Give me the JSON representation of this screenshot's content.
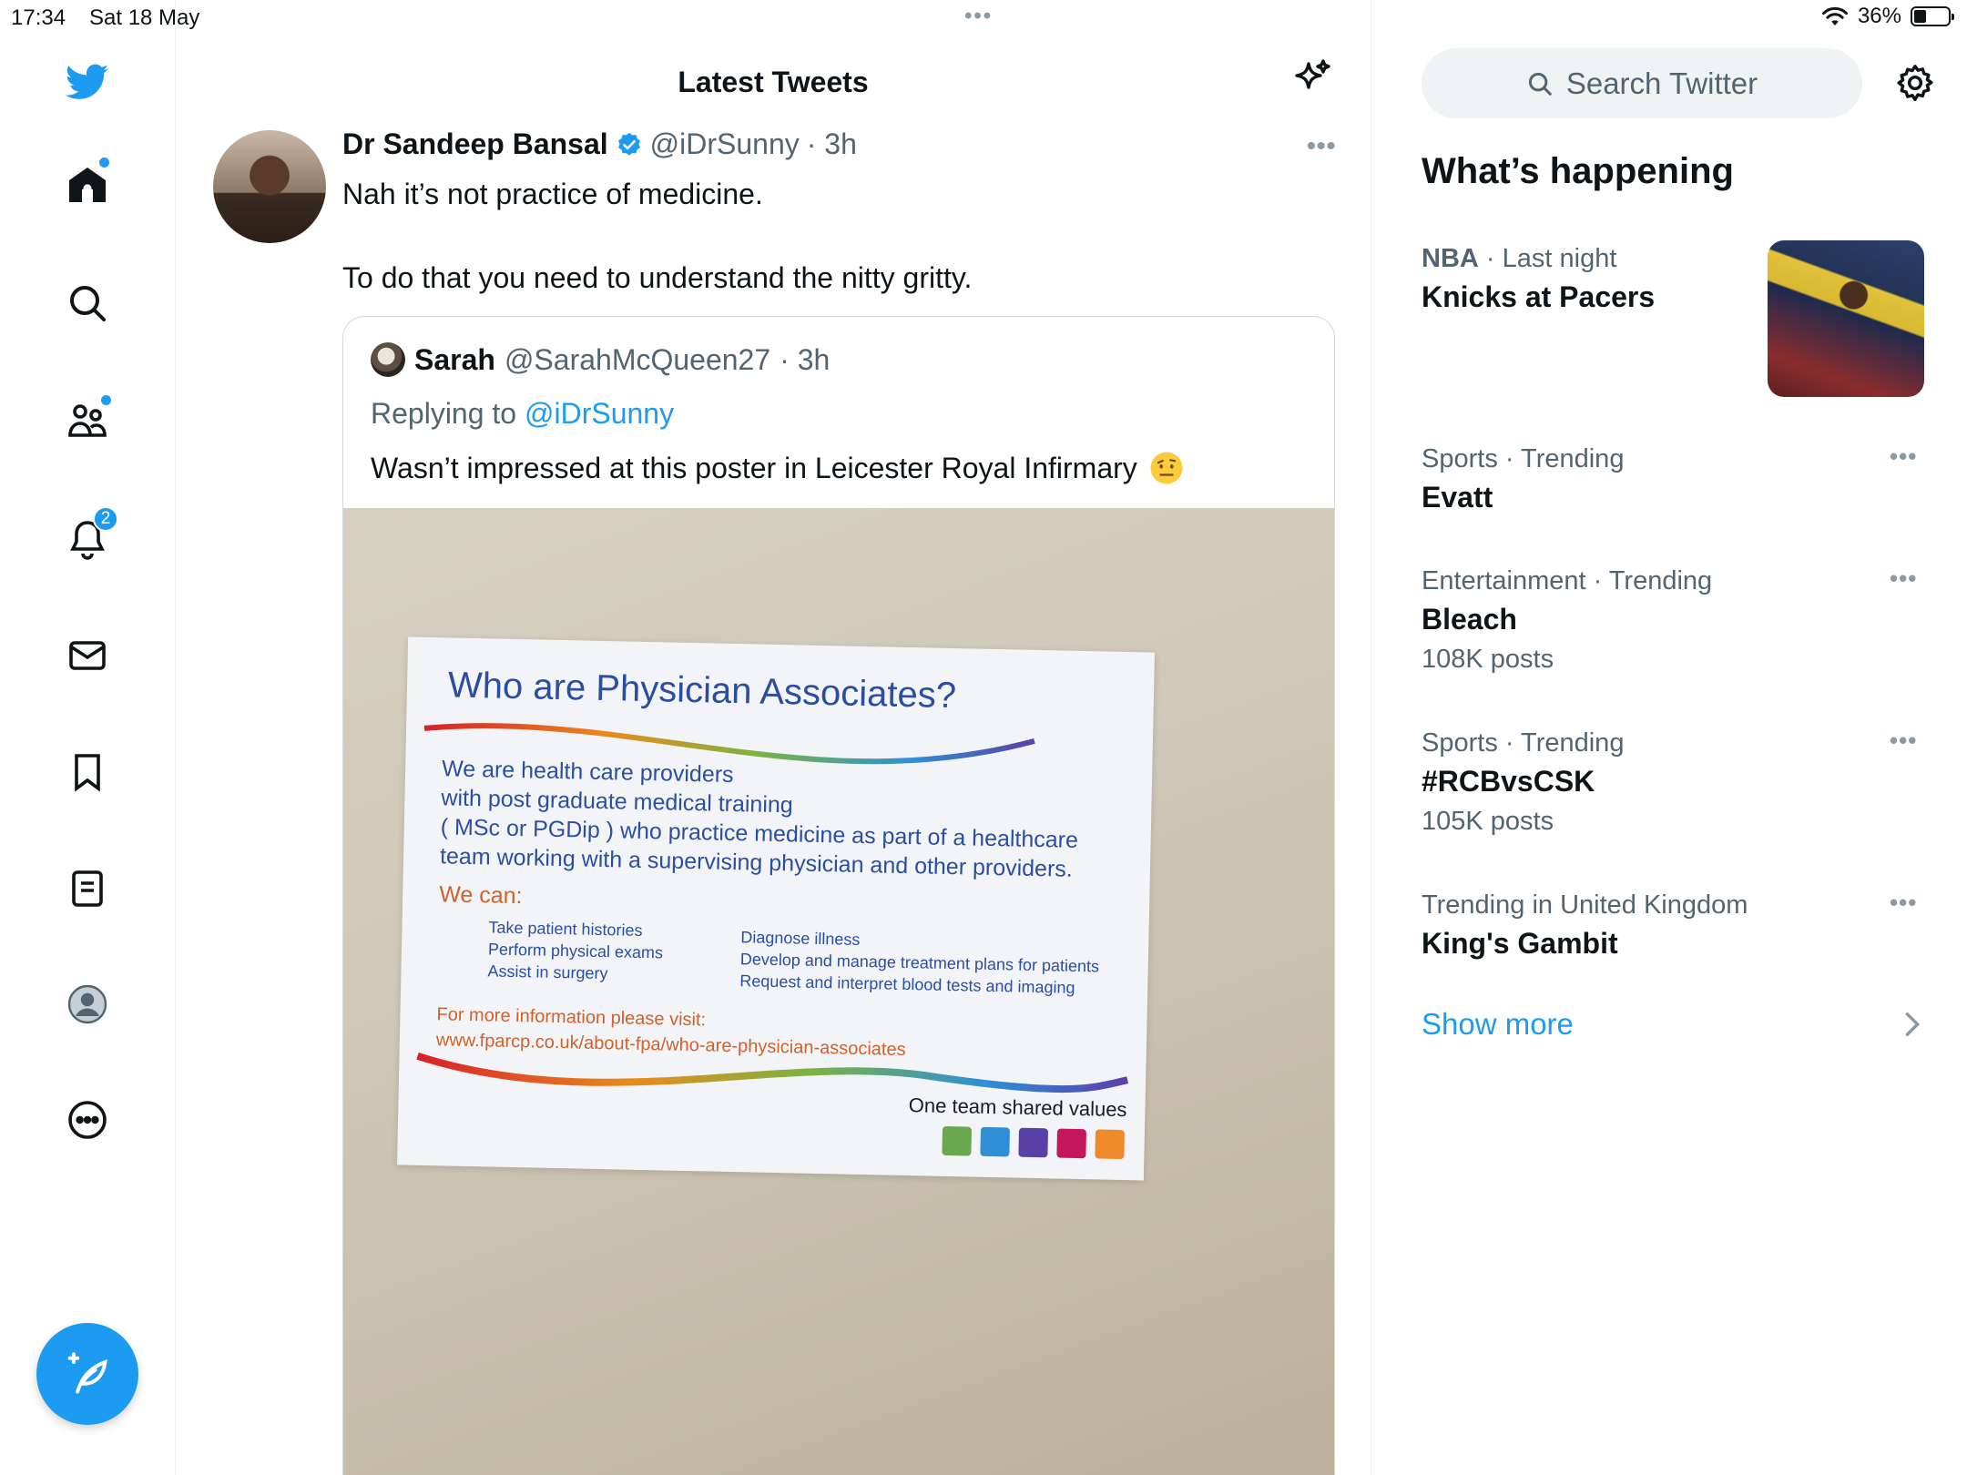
{
  "status_bar": {
    "time": "17:34",
    "date": "Sat 18 May",
    "battery": "36%"
  },
  "nav": {
    "notifications_badge": "2"
  },
  "header": {
    "title": "Latest Tweets"
  },
  "tweet": {
    "name": "Dr Sandeep Bansal",
    "handle": "@iDrSunny",
    "time": "· 3h",
    "lines": [
      "Nah it’s not practice of medicine.",
      "To do that you need to understand the nitty gritty."
    ],
    "quote": {
      "name": "Sarah",
      "handle": "@SarahMcQueen27",
      "time": "· 3h",
      "replying_prefix": "Replying to",
      "replying_handle": "@iDrSunny",
      "text": "Wasn’t impressed at this poster in Leicester Royal Infirmary",
      "poster": {
        "title": "Who are Physician Associates?",
        "para": [
          "We are health care providers",
          "with post graduate medical training",
          "( MSc or PGDip ) who practice medicine as part of a healthcare",
          "team working with a supervising physician and other providers."
        ],
        "we_can": "We can:",
        "list_left": [
          "Take patient histories",
          "Perform physical exams",
          "Assist in surgery"
        ],
        "list_right": [
          "Diagnose illness",
          "Develop and manage treatment plans for patients",
          "Request and interpret blood tests and imaging"
        ],
        "info_label": "For more information please visit:",
        "info_url": "www.fparcp.co.uk/about-fpa/who-are-physician-associates",
        "shared": "One team shared values"
      }
    }
  },
  "search": {
    "placeholder": "Search Twitter"
  },
  "sidebar": {
    "title": "What’s happening",
    "trends": [
      {
        "meta_bold": "NBA",
        "meta": "· Last night",
        "name": "Knicks at Pacers",
        "count": ""
      },
      {
        "meta_bold": "",
        "meta": "Sports · Trending",
        "name": "Evatt",
        "count": ""
      },
      {
        "meta_bold": "",
        "meta": "Entertainment · Trending",
        "name": "Bleach",
        "count": "108K posts"
      },
      {
        "meta_bold": "",
        "meta": "Sports · Trending",
        "name": "#RCBvsCSK",
        "count": "105K posts"
      },
      {
        "meta_bold": "",
        "meta": "Trending in United Kingdom",
        "name": "King's Gambit",
        "count": ""
      }
    ],
    "show_more": "Show more"
  },
  "colors": {
    "accent": "#1d9bf0",
    "muted": "#536471"
  }
}
